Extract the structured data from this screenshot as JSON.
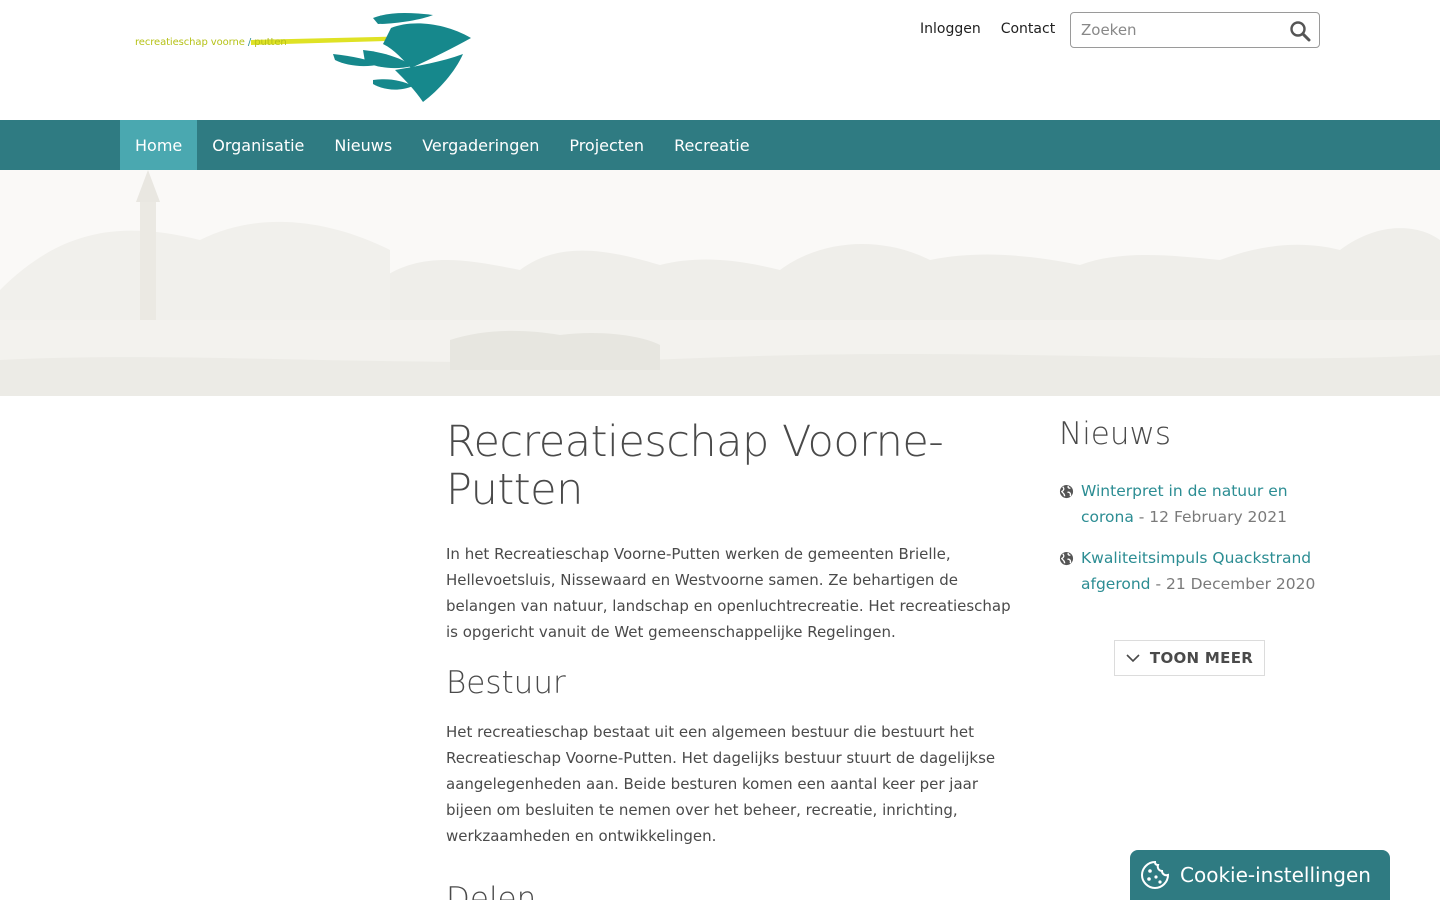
{
  "header": {
    "logo_text_left": "recreatieschap voorne",
    "logo_text_slash": "/",
    "logo_text_right": "putten",
    "links": [
      "Inloggen",
      "Contact"
    ],
    "search_placeholder": "Zoeken"
  },
  "nav": {
    "items": [
      "Home",
      "Organisatie",
      "Nieuws",
      "Vergaderingen",
      "Projecten",
      "Recreatie"
    ],
    "active": "Home"
  },
  "main": {
    "title": "Recreatieschap Voorne-Putten",
    "intro": "In het Recreatieschap Voorne-Putten werken de gemeenten Brielle, Hellevoetsluis, Nissewaard en Westvoorne samen. Ze behartigen de belangen van natuur, landschap en openluchtrecreatie. Het recreatieschap is opgericht vanuit de Wet gemeenschappelijke Regelingen.",
    "bestuur_heading": "Bestuur",
    "bestuur_text": "Het recreatieschap bestaat uit een algemeen bestuur die bestuurt het Recreatieschap Voorne-Putten. Het dagelijks bestuur stuurt de dagelijkse aangelegenheden aan. Beide besturen komen een aantal keer per jaar bijeen om besluiten te nemen over het beheer, recreatie, inrichting, werkzaamheden en ontwikkelingen.",
    "delen_heading": "Delen"
  },
  "sidebar": {
    "heading": "Nieuws",
    "news": [
      {
        "title": "Winterpret in de natuur en corona",
        "date": "- 12 February 2021"
      },
      {
        "title": "Kwaliteitsimpuls Quackstrand afgerond",
        "date": "- 21 December 2020"
      }
    ],
    "more_label": "TOON MEER"
  },
  "cookie": {
    "label": "Cookie-instellingen"
  },
  "colors": {
    "nav_bg": "#2f7b82",
    "nav_active": "#4aa8b0",
    "link": "#2c8d93",
    "logo_yellow": "#b6c218"
  }
}
